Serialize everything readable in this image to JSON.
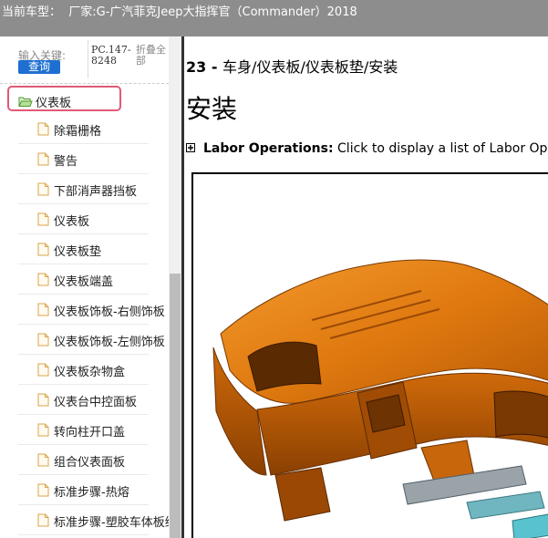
{
  "header": {
    "vehicle_prefix": "当前车型：",
    "vehicle": "厂家:G-广汽菲克Jeep大指挥官（Commander）2018"
  },
  "search": {
    "keyword_label": "输入关键:",
    "search_button": "查询",
    "pc_code": "PC.147-8248",
    "collapse_all": "折叠全部"
  },
  "tree": {
    "root_label": "仪表板",
    "items": [
      "除霜栅格",
      "警告",
      "下部消声器挡板",
      "仪表板",
      "仪表板垫",
      "仪表板端盖",
      "仪表板饰板-右侧饰板",
      "仪表板饰板-左侧饰板",
      "仪表板杂物盒",
      "仪表台中控面板",
      "转向柱开口盖",
      "组合仪表面板",
      "标准步骤-热熔",
      "标准步骤-塑胶车体板维修"
    ]
  },
  "document": {
    "heading_number": "23 - ",
    "heading_path": "车身/仪表板/仪表板垫/安装",
    "section_title": "安装",
    "labor_label": "Labor Operations:",
    "labor_text": " Click to display a list of Labor Operations"
  },
  "colors": {
    "header_bg": "#8d8d8d",
    "search_button": "#1e6fd1",
    "selection_border": "#e05a78",
    "part_orange": "#e07a10"
  },
  "icons": {
    "root": "folder-open-icon",
    "item": "document-icon",
    "expand": "plus-box-icon"
  }
}
